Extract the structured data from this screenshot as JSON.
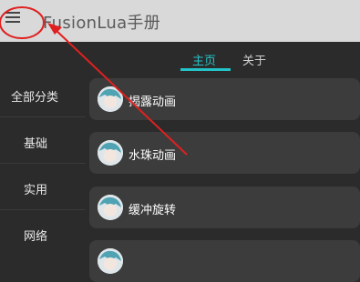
{
  "app_bar": {
    "title": "FusionLua手册",
    "menu_icon": "menu-icon"
  },
  "tabs": [
    {
      "label": "主页",
      "selected": true
    },
    {
      "label": "关于",
      "selected": false
    }
  ],
  "sidebar": {
    "items": [
      {
        "label": "全部分类"
      },
      {
        "label": "基础"
      },
      {
        "label": "实用"
      },
      {
        "label": "网络"
      }
    ]
  },
  "cards": [
    {
      "label": "揭露动画",
      "icon": "avatar-icon"
    },
    {
      "label": "水珠动画",
      "icon": "avatar-icon"
    },
    {
      "label": "缓冲旋转",
      "icon": "avatar-icon"
    },
    {
      "label": "",
      "icon": "avatar-icon"
    }
  ],
  "colors": {
    "accent": "#23c3c8",
    "annotation": "#e02020",
    "app_bar_bg": "#d9d9d9",
    "background": "#2b2b2b",
    "card_bg": "#3c3c3c"
  }
}
